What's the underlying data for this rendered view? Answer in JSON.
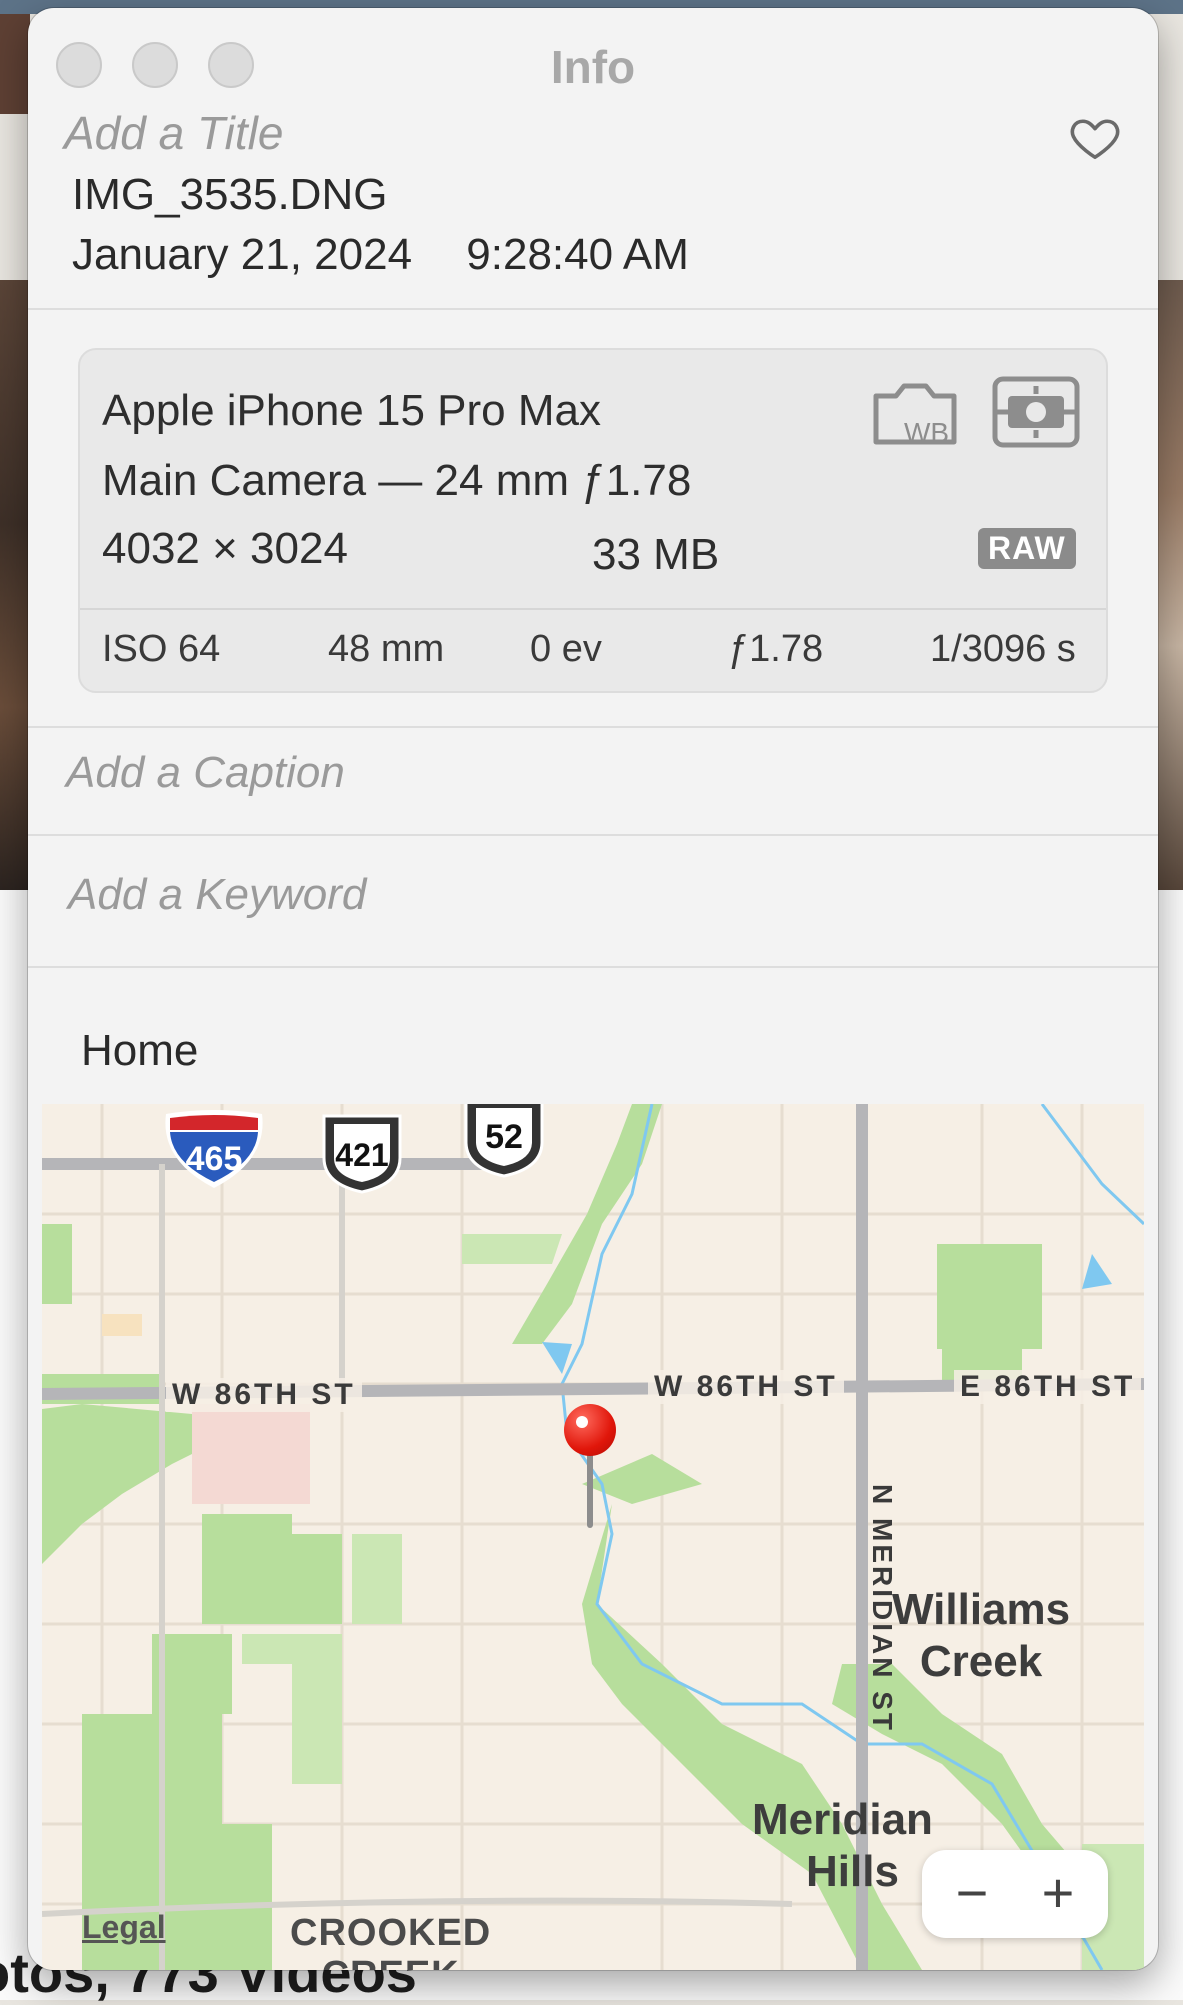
{
  "background": {
    "library_count_text": "otos, 773 Videos"
  },
  "window": {
    "title": "Info"
  },
  "info": {
    "title_placeholder": "Add a Title",
    "filename": "IMG_3535.DNG",
    "date": "January 21, 2024",
    "time": "9:28:40 AM",
    "favorite_icon": "heart-icon"
  },
  "camera": {
    "model": "Apple iPhone 15 Pro Max",
    "lens": "Main Camera — 24 mm ƒ1.78",
    "dimensions": "4032 × 3024",
    "file_size": "33 MB",
    "format_badge": "RAW",
    "icons": [
      "white-balance-icon",
      "metering-icon"
    ],
    "exif": {
      "iso": "ISO 64",
      "focal_length": "48 mm",
      "exposure_bias": "0 ev",
      "aperture": "ƒ1.78",
      "shutter": "1/3096 s"
    }
  },
  "fields": {
    "caption_placeholder": "Add a Caption",
    "keyword_placeholder": "Add a Keyword"
  },
  "location": {
    "name": "Home"
  },
  "map": {
    "shields": {
      "interstate": "465",
      "us_a": "421",
      "us_b": "52"
    },
    "streets": {
      "w86_left": "W 86TH ST",
      "w86_right": "W 86TH ST",
      "e86": "E 86TH ST",
      "meridian": "N MERIDIAN ST"
    },
    "areas": {
      "williams_creek_1": "Williams",
      "williams_creek_2": "Creek",
      "meridian_hills_1": "Meridian",
      "meridian_hills_2": "Hills",
      "crooked_creek_1": "CROOKED",
      "crooked_creek_2": "CREEK"
    },
    "legal": "Legal",
    "zoom_out": "−",
    "zoom_in": "+",
    "colors": {
      "land": "#f6efe5",
      "park": "#b7de9c",
      "water": "#7fc8f0",
      "road": "#b5b5b8",
      "pin": "#e0160a"
    }
  }
}
